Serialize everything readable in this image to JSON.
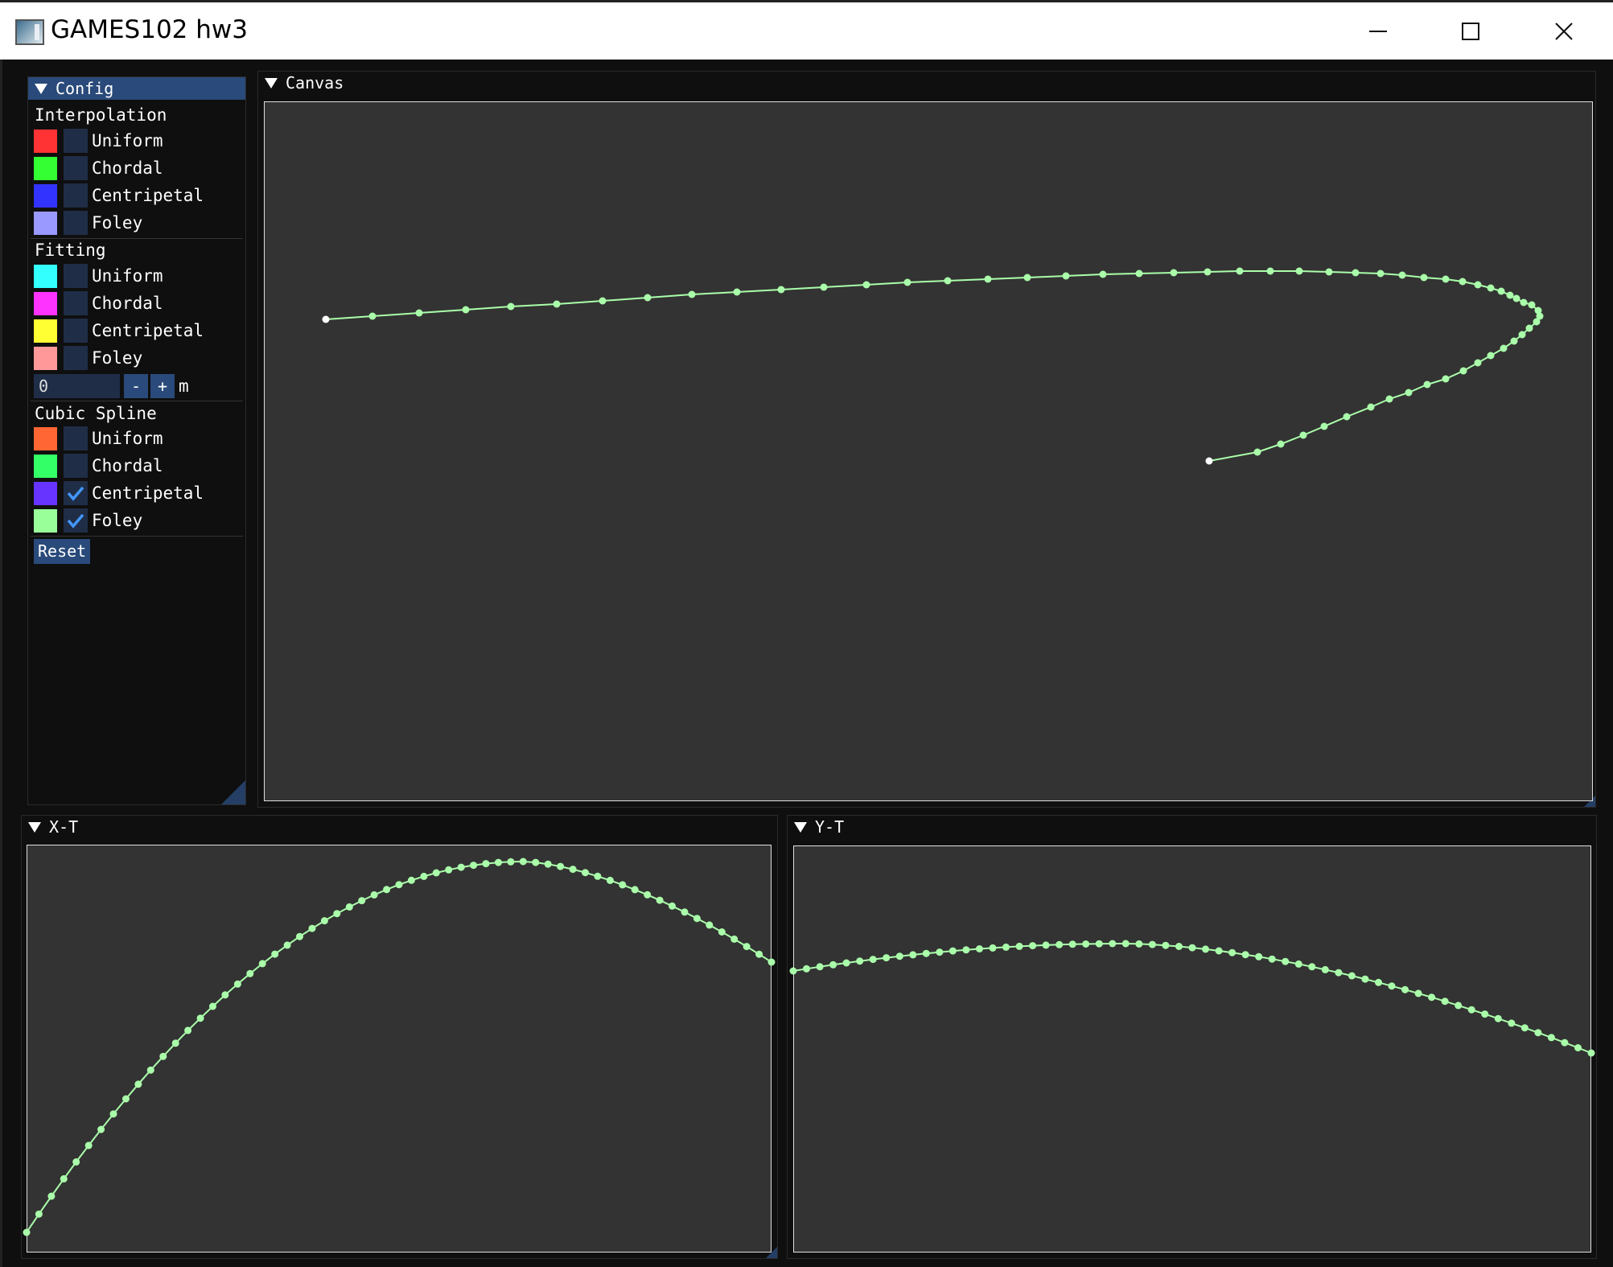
{
  "window": {
    "title": "GAMES102 hw3"
  },
  "config": {
    "panel_title": "Config",
    "interpolation": {
      "title": "Interpolation",
      "items": [
        {
          "label": "Uniform",
          "color": "#ff3333",
          "checked": false
        },
        {
          "label": "Chordal",
          "color": "#33ff33",
          "checked": false
        },
        {
          "label": "Centripetal",
          "color": "#3333ff",
          "checked": false
        },
        {
          "label": "Foley",
          "color": "#9999ff",
          "checked": false
        }
      ]
    },
    "fitting": {
      "title": "Fitting",
      "items": [
        {
          "label": "Uniform",
          "color": "#33ffff",
          "checked": false
        },
        {
          "label": "Chordal",
          "color": "#ff33ff",
          "checked": false
        },
        {
          "label": "Centripetal",
          "color": "#ffff33",
          "checked": false
        },
        {
          "label": "Foley",
          "color": "#ff9999",
          "checked": false
        }
      ],
      "m_value": "0",
      "minus_label": "-",
      "plus_label": "+",
      "m_label": "m"
    },
    "cubic_spline": {
      "title": "Cubic Spline",
      "items": [
        {
          "label": "Uniform",
          "color": "#ff6633",
          "checked": false
        },
        {
          "label": "Chordal",
          "color": "#33ff66",
          "checked": false
        },
        {
          "label": "Centripetal",
          "color": "#6633ff",
          "checked": true
        },
        {
          "label": "Foley",
          "color": "#99ff99",
          "checked": true
        }
      ]
    },
    "reset_label": "Reset"
  },
  "canvas": {
    "title": "Canvas"
  },
  "xt": {
    "title": "X-T"
  },
  "yt": {
    "title": "Y-T"
  },
  "curve_color": "#aaffaa",
  "endpoint_color": "#ffffff"
}
